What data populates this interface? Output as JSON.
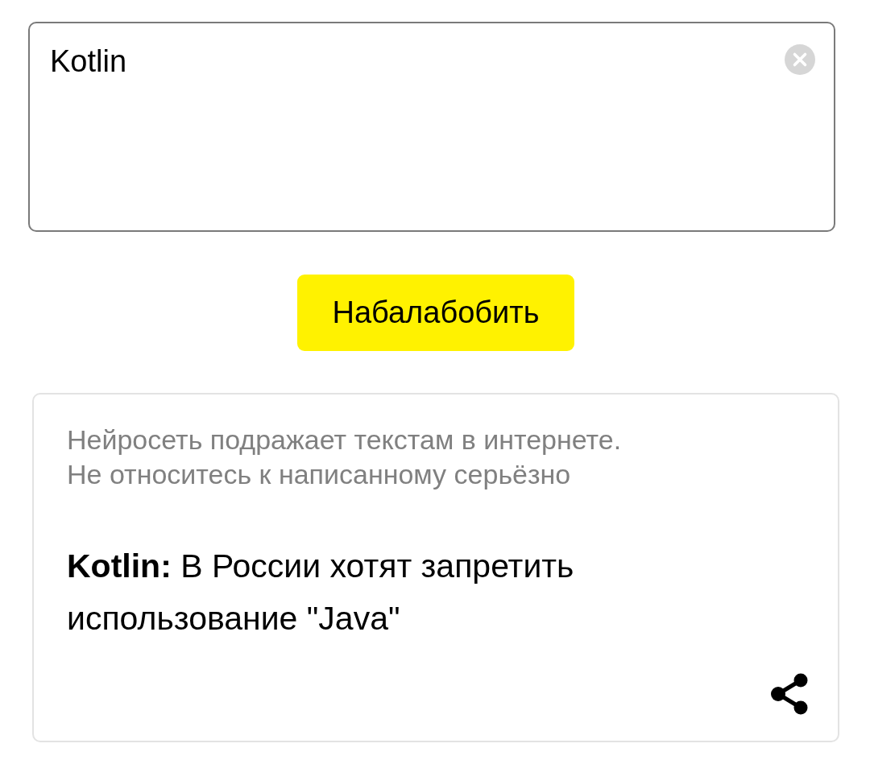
{
  "query_field": {
    "value": "Kotlin"
  },
  "submit_button": {
    "label": "Набалабобить"
  },
  "result_card": {
    "disclaimer_lines": [
      "Нейросеть подражает текстам в интернете.",
      "Не относитесь к написанному серьёзно"
    ],
    "text": "**Kotlin:** В России хотят запретить использование \"Java\""
  }
}
